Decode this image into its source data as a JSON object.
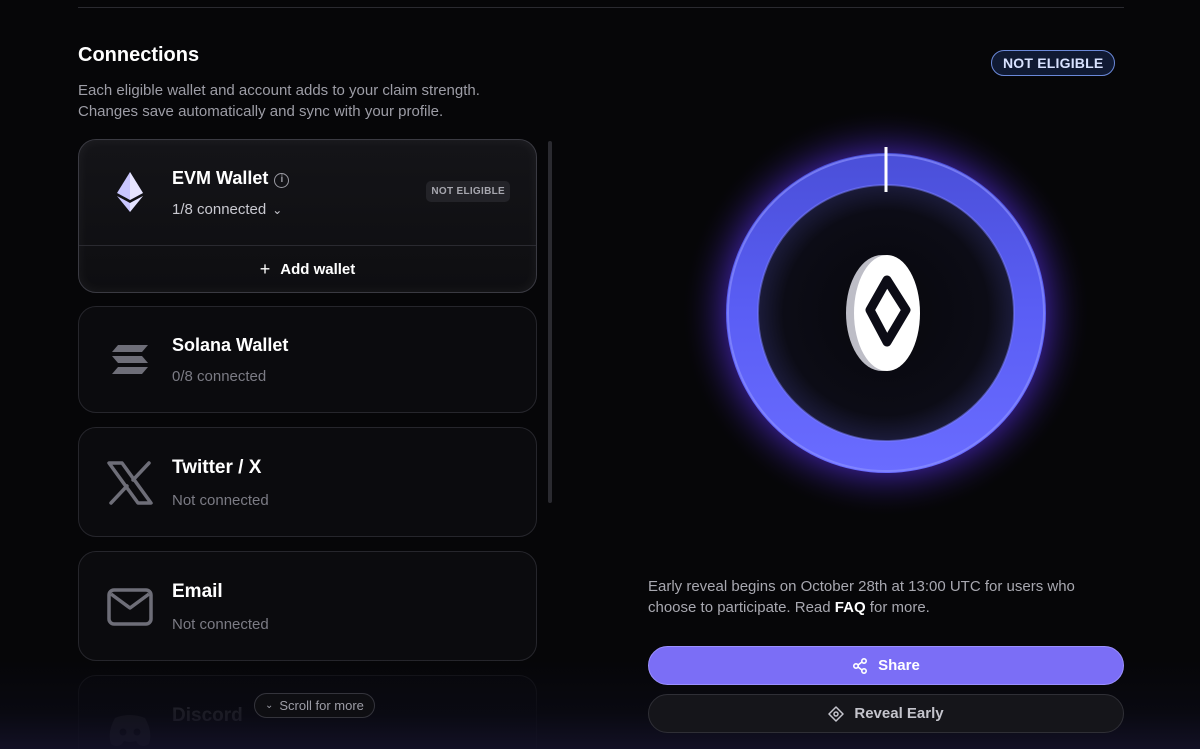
{
  "connections": {
    "title": "Connections",
    "desc_line1": "Each eligible wallet and account adds to your claim strength.",
    "desc_line2": "Changes save automatically and sync with your profile.",
    "scroll_hint": "Scroll for more",
    "items": [
      {
        "name": "EVM Wallet",
        "status": "1/8 connected",
        "badge": "NOT ELIGIBLE",
        "add_label": "Add wallet",
        "icon": "ethereum-icon"
      },
      {
        "name": "Solana Wallet",
        "status": "0/8 connected",
        "icon": "solana-icon"
      },
      {
        "name": "Twitter / X",
        "status": "Not connected",
        "icon": "x-icon"
      },
      {
        "name": "Email",
        "status": "Not connected",
        "icon": "mail-icon"
      },
      {
        "name": "Discord",
        "status": "",
        "icon": "discord-icon"
      }
    ]
  },
  "eligibility": {
    "badge": "NOT ELIGIBLE"
  },
  "reveal": {
    "line1": "Early reveal begins on October 28th at 13:00 UTC for users who",
    "line2_prefix": "choose to participate. Read ",
    "faq_link": "FAQ",
    "line2_suffix": " for more."
  },
  "actions": {
    "share_label": "Share",
    "reveal_label": "Reveal Early"
  },
  "colors": {
    "accent": "#7b6ef6",
    "ring": "#5b4cf0",
    "background": "#060608"
  }
}
